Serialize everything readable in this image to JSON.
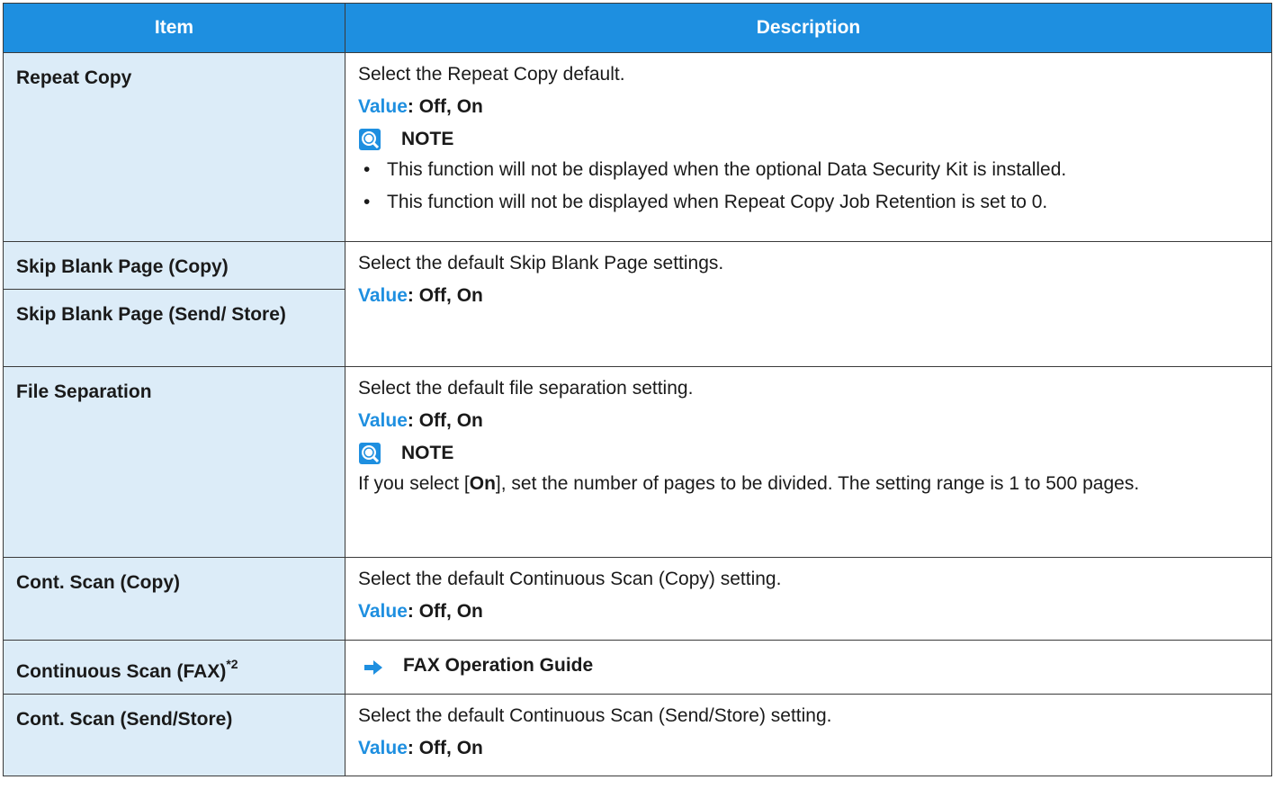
{
  "header": {
    "item": "Item",
    "description": "Description"
  },
  "value_label": "Value",
  "rows": {
    "repeat_copy": {
      "item": "Repeat Copy",
      "desc": "Select the Repeat Copy default.",
      "value": ": Off, On",
      "note_title": "NOTE",
      "bullets": [
        "This function will not be displayed when the optional Data Security Kit is installed.",
        "This function will not be displayed when Repeat Copy Job Retention is set to 0."
      ]
    },
    "skip_blank_copy": {
      "item": "Skip Blank Page (Copy)"
    },
    "skip_blank_send": {
      "item": "Skip Blank Page (Send/ Store)",
      "desc": "Select the default Skip Blank Page settings.",
      "value": ": Off, On"
    },
    "file_separation": {
      "item": "File Separation",
      "desc": "Select the default file separation setting.",
      "value": ": Off, On",
      "note_title": "NOTE",
      "note_pre": "If you select [",
      "note_bold": "On",
      "note_post": "], set the number of pages to be divided. The setting range is 1 to 500 pages."
    },
    "cont_scan_copy": {
      "item": "Cont. Scan (Copy)",
      "desc": "Select the default Continuous Scan (Copy) setting.",
      "value": ": Off, On"
    },
    "cont_scan_fax": {
      "item": "Continuous Scan (FAX)",
      "footnote": "*2",
      "ref": "FAX Operation Guide"
    },
    "cont_scan_send": {
      "item": "Cont. Scan (Send/Store)",
      "desc": "Select the default Continuous Scan (Send/Store) setting.",
      "value": ": Off, On"
    }
  },
  "colors": {
    "header_bg": "#1e8fe0",
    "item_bg": "#dcecf8",
    "value_label": "#1e8fe0",
    "arrow": "#1e8fe0"
  },
  "icons": {
    "note": "note-icon",
    "reference": "arrow-right-icon"
  }
}
